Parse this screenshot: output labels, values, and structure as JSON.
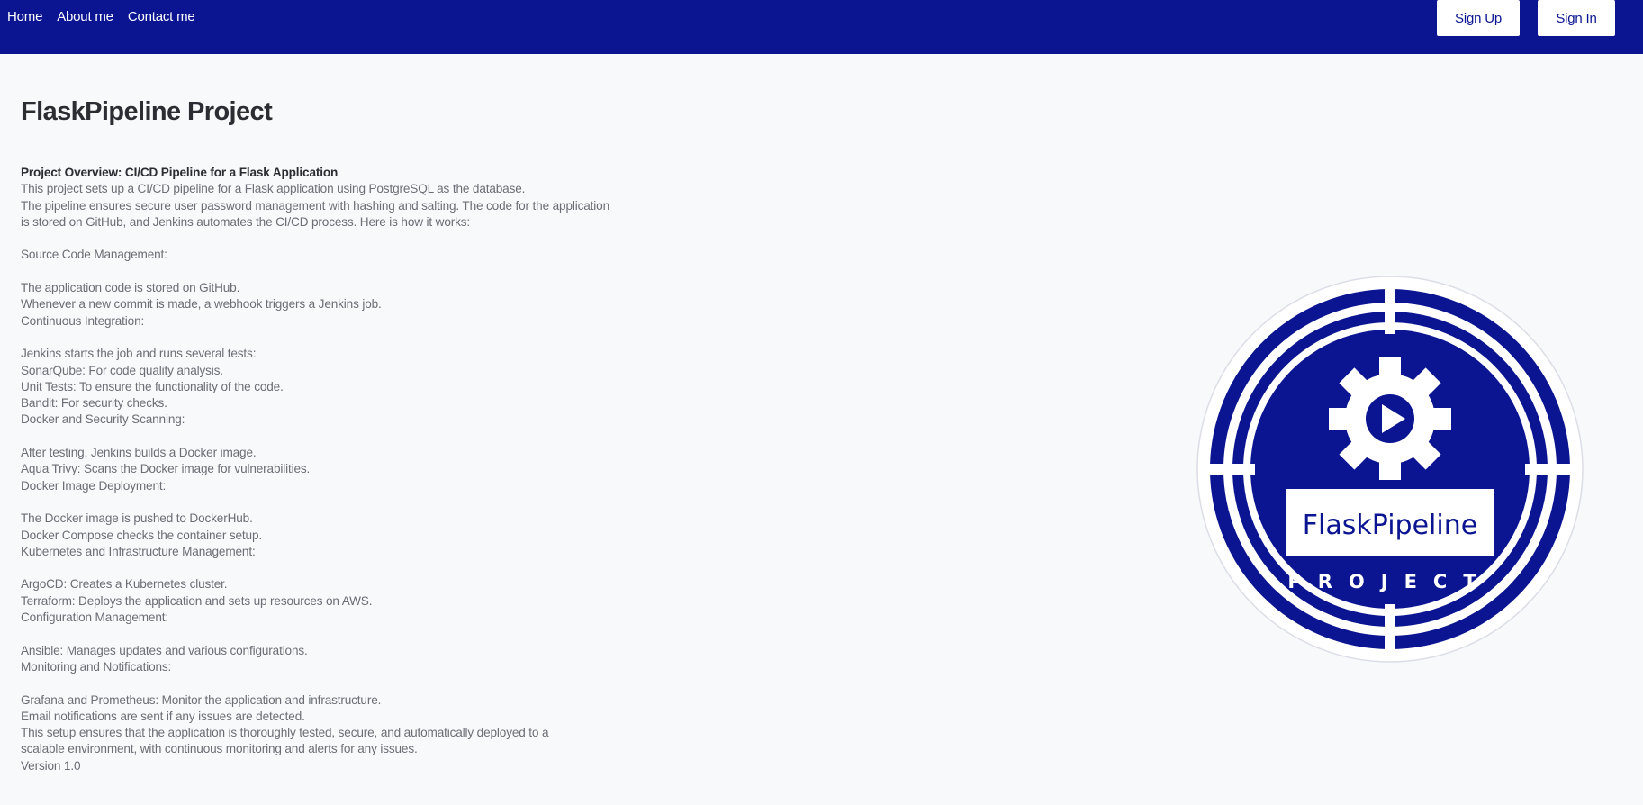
{
  "nav": {
    "links": [
      "Home",
      "About me",
      "Contact me"
    ],
    "signup_label": "Sign Up",
    "signin_label": "Sign In"
  },
  "page": {
    "title": "FlaskPipeline Project",
    "overview_heading": "Project Overview: CI/CD Pipeline for a Flask Application",
    "lines": [
      "This project sets up a CI/CD pipeline for a Flask application using PostgreSQL as the database.",
      "The pipeline ensures secure user password management with hashing and salting. The code for the application",
      "is stored on GitHub, and Jenkins automates the CI/CD process. Here is how it works:",
      "",
      "Source Code Management:",
      "",
      "The application code is stored on GitHub.",
      "Whenever a new commit is made, a webhook triggers a Jenkins job.",
      "Continuous Integration:",
      "",
      "Jenkins starts the job and runs several tests:",
      "SonarQube: For code quality analysis.",
      "Unit Tests: To ensure the functionality of the code.",
      "Bandit: For security checks.",
      "Docker and Security Scanning:",
      "",
      "After testing, Jenkins builds a Docker image.",
      "Aqua Trivy: Scans the Docker image for vulnerabilities.",
      "Docker Image Deployment:",
      "",
      "The Docker image is pushed to DockerHub.",
      "Docker Compose checks the container setup.",
      "Kubernetes and Infrastructure Management:",
      "",
      "ArgoCD: Creates a Kubernetes cluster.",
      "Terraform: Deploys the application and sets up resources on AWS.",
      "Configuration Management:",
      "",
      "Ansible: Manages updates and various configurations.",
      "Monitoring and Notifications:",
      "",
      "Grafana and Prometheus: Monitor the application and infrastructure.",
      "Email notifications are sent if any issues are detected.",
      "This setup ensures that the application is thoroughly tested, secure, and automatically deployed to a",
      "scalable environment, with continuous monitoring and alerts for any issues.",
      "Version 1.0"
    ]
  },
  "logo": {
    "icon": "gear-play-icon",
    "name": "FlaskPipeline",
    "subtitle": "PROJECT"
  },
  "colors": {
    "brand": "#0b1591",
    "background": "#f8f9fb",
    "text_dark": "#2b2d33",
    "text_muted": "#6b6e75"
  }
}
